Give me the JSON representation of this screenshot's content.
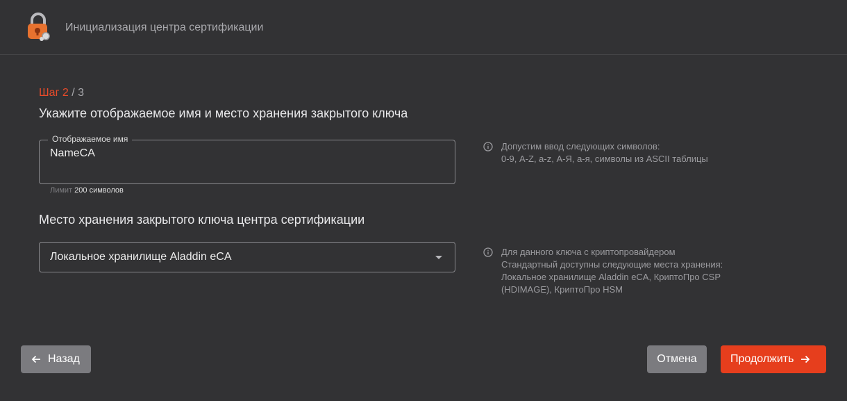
{
  "header": {
    "title": "Инициализация центра сертификации",
    "logo_icon": "lock-shield-logo-icon"
  },
  "step": {
    "current": "Шаг 2",
    "total": " / 3"
  },
  "heading": "Укажите отображаемое имя и место хранения закрытого ключа",
  "display_name": {
    "label": "Отображаемое имя",
    "value": "NameCA",
    "limit_label": "Лимит",
    "limit_value": "200 символов",
    "hint": "Допустим ввод следующих символов:\n0-9, A-Z, a-z, А-Я, а-я, символы из ASCII таблицы"
  },
  "storage": {
    "heading": "Место хранения закрытого ключа центра сертификации",
    "selected": "Локальное хранилище Aladdin eCA",
    "hint": "Для данного ключа с криптопровайдером\nСтандартный доступны следующие места хранения:\nЛокальное хранилище Aladdin eCA, КриптоПро CSP\n(HDIMAGE), КриптоПро HSM"
  },
  "footer": {
    "back_label": "Назад",
    "cancel_label": "Отмена",
    "next_label": "Продолжить"
  },
  "colors": {
    "accent": "#e63e1d",
    "background": "#323234",
    "button_gray": "#7b7b7f"
  }
}
